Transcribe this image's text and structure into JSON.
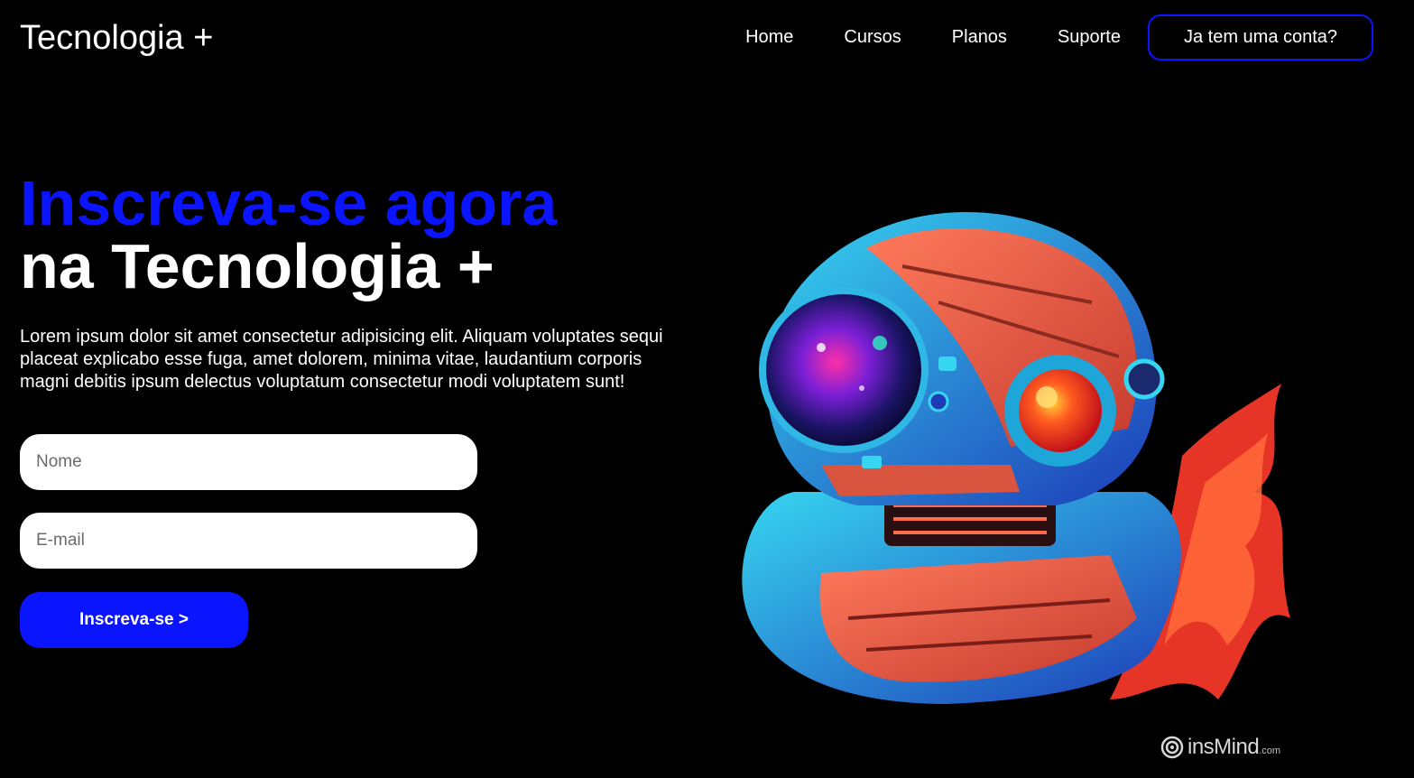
{
  "header": {
    "logo": "Tecnologia +",
    "nav": [
      {
        "label": "Home"
      },
      {
        "label": "Cursos"
      },
      {
        "label": "Planos"
      },
      {
        "label": "Suporte"
      }
    ],
    "account_button": "Ja tem uma conta?"
  },
  "hero": {
    "title_accent": "Inscreva-se agora",
    "title_rest": "na Tecnologia +",
    "description": "Lorem ipsum dolor sit amet consectetur adipisicing elit. Aliquam voluptates sequi placeat explicabo esse fuga, amet dolorem, minima vitae, laudantium corporis magni debitis ipsum delectus voluptatum consectetur modi voluptatem sunt!"
  },
  "form": {
    "name_placeholder": "Nome",
    "email_placeholder": "E-mail",
    "submit_label": "Inscreva-se >"
  },
  "illustration": {
    "subject": "astronaut-robot-helmet",
    "watermark": "insMind",
    "watermark_suffix": ".com"
  },
  "colors": {
    "background": "#000000",
    "accent": "#0a14ff",
    "text": "#ffffff"
  }
}
